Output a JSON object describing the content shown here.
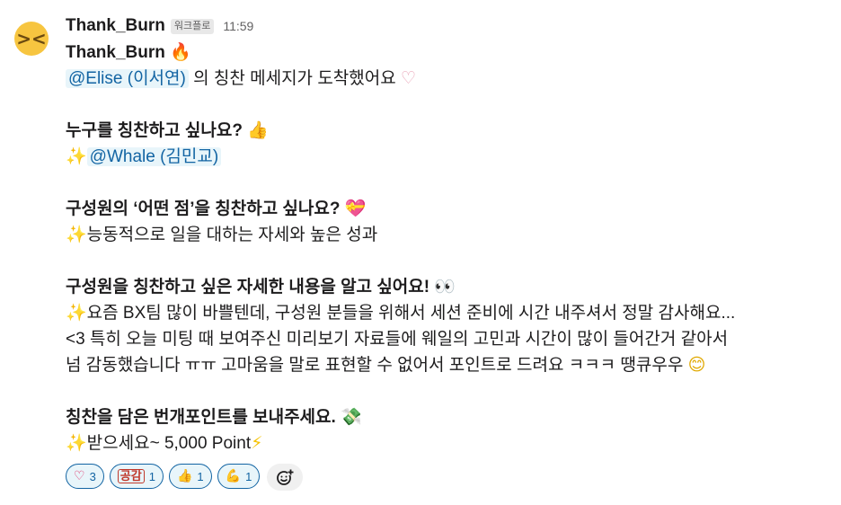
{
  "message": {
    "sender": "Thank_Burn",
    "app_badge": "워크플로",
    "time": "11:59",
    "avatar_icon": "grinning-squinting-face-icon",
    "title": "Thank_Burn",
    "mention_line": {
      "mention": "@Elise (이서연)",
      "text": " 의 칭찬 메세지가 도착했어요"
    },
    "q1": {
      "question": "누구를 칭찬하고 싶나요?",
      "mention": "@Whale (김민교)"
    },
    "q2": {
      "question": "구성원의 ‘어떤 점’을 칭찬하고 싶나요?",
      "answer": "능동적으로 일을 대하는 자세와 높은 성과"
    },
    "q3": {
      "question": "구성원을 칭찬하고 싶은 자세한 내용을 알고 싶어요!",
      "answer_lines": [
        "요즘 BX팀 많이 바쁠텐데, 구성원 분들을 위해서 세션 준비에 시간 내주셔서 정말 감사해요...",
        "<3 특히 오늘 미팅 때 보여주신 미리보기 자료들에 웨일의 고민과 시간이 많이 들어간거 같아서",
        "넘  감동했습니다 ㅠㅠ 고마움을 말로 표현할 수 없어서 포인트로 드려요 ㅋㅋㅋ 땡큐우우"
      ]
    },
    "q4": {
      "question": "칭찬을 담은 번개포인트를 보내주세요.",
      "answer": "받으세요~ 5,000 Point"
    }
  },
  "reactions": [
    {
      "icon": "heart-outline-icon",
      "count": "3"
    },
    {
      "icon": "gonggam-text-icon",
      "label": "공감",
      "count": "1"
    },
    {
      "icon": "thumbs-up-icon",
      "count": "1"
    },
    {
      "icon": "flexed-biceps-icon",
      "count": "1"
    }
  ],
  "add_reaction_icon": "add-reaction-icon"
}
